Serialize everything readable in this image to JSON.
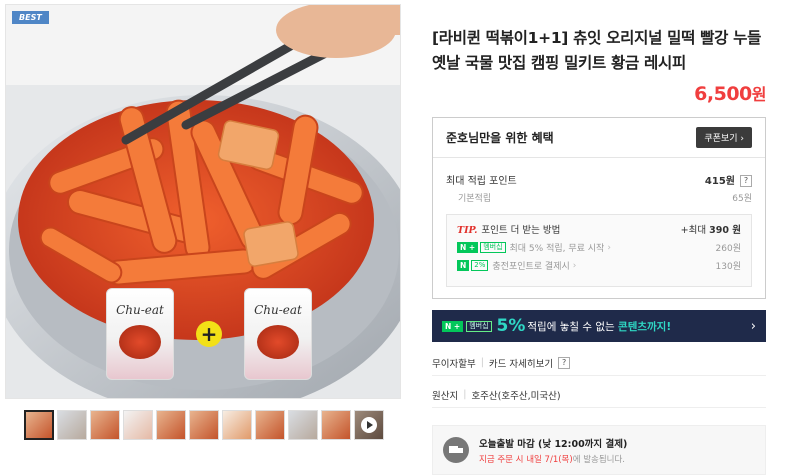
{
  "gallery": {
    "badge": "BEST",
    "pack_brand": "Chu-eat",
    "thumbnails": 11
  },
  "product": {
    "title": "[라비퀸 떡볶이1+1] 츄잇 오리지널 밀떡 빨강 누들 옛날 국물 맛집 캠핑 밀키트 황금 레시피",
    "price": "6,500",
    "price_unit": "원"
  },
  "benefit": {
    "title": "준호님만을 위한 혜택",
    "coupon_button": "쿠폰보기 ›",
    "max_points_label": "최대 적립 포인트",
    "max_points_value": "415원",
    "base_label": "기본적립",
    "base_value": "65원",
    "tip": {
      "label": "TIP.",
      "text": "포인트 더 받는 방법",
      "max_prefix": "+최대 ",
      "max_value": "390 원",
      "rows": [
        {
          "text": "최대 5% 적립, 무료 시작",
          "value": "260원"
        },
        {
          "text": "충전포인트로 결제시",
          "value": "130원"
        }
      ]
    }
  },
  "banner": {
    "pct": "5%",
    "text": "적립에 놓칠 수 없는 ",
    "highlight": "콘텐츠까지!",
    "arrow": "›"
  },
  "payment": {
    "interest_free": "무이자할부",
    "card_link": "카드 자세히보기"
  },
  "origin": {
    "label": "원산지",
    "value": "호주산(호주산,미국산)"
  },
  "shipping": {
    "title": "오늘출발 마감 (낮 12:00까지 결제)",
    "sub_red": "지금 주문 시 내일 7/1(목)",
    "sub_rest": "에 발송됩니다."
  },
  "colors": {
    "price": "#f03e3e",
    "banner_bg": "#1f2a4a",
    "banner_accent": "#2fd7c4",
    "npay": "#03c75a"
  }
}
